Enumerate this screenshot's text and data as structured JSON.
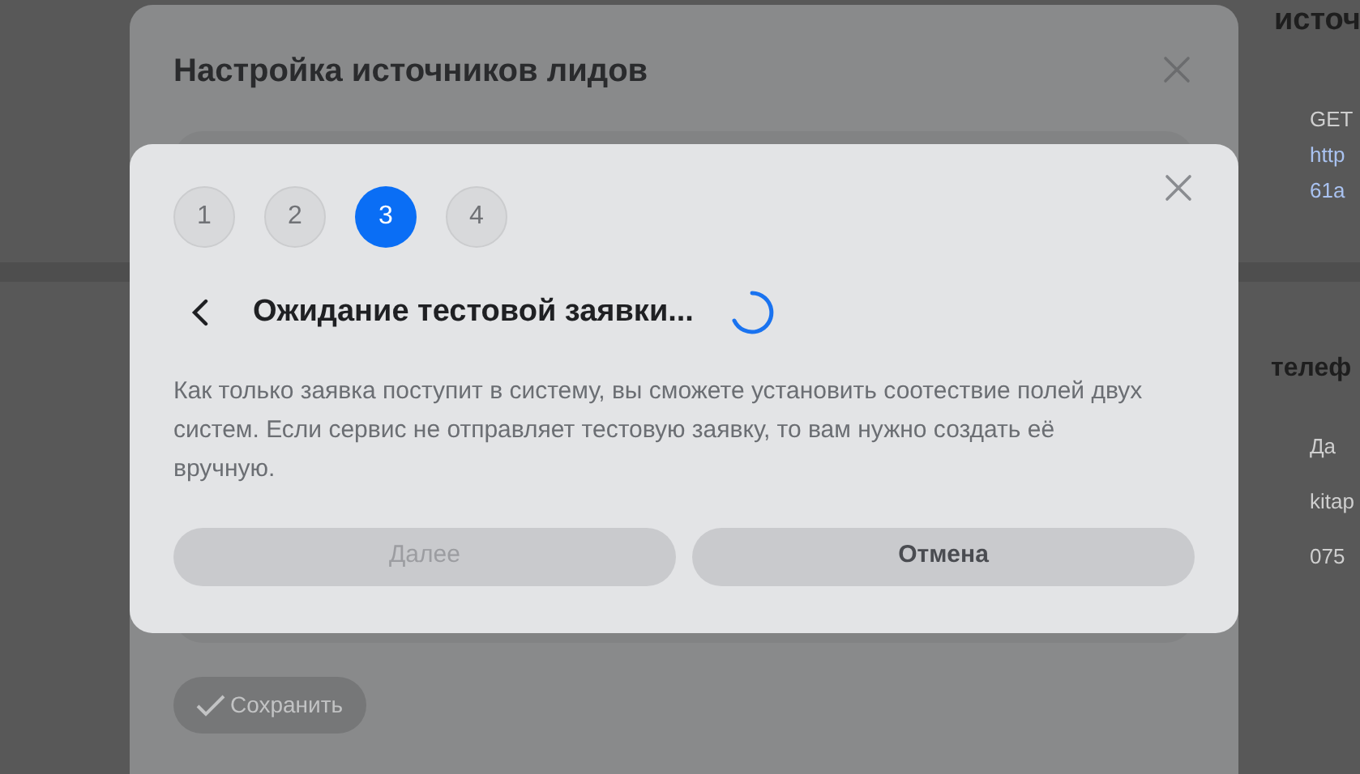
{
  "background_page": {
    "heading": "источ",
    "request": [
      {
        "kind": "method",
        "text": "GET"
      },
      {
        "kind": "link",
        "text": "http"
      },
      {
        "kind": "link",
        "text": "61a"
      }
    ],
    "section_heading": "телеф",
    "values": [
      "Да",
      "kitap",
      "075"
    ]
  },
  "settings_dialog": {
    "title": "Настройка источников лидов",
    "save_button": {
      "label": "Сохранить",
      "disabled": true
    }
  },
  "wizard_dialog": {
    "steps": [
      {
        "label": "1",
        "selected": false
      },
      {
        "label": "2",
        "selected": false
      },
      {
        "label": "3",
        "selected": true
      },
      {
        "label": "4",
        "selected": false
      }
    ],
    "title": "Ожидание тестовой заявки...",
    "loading": true,
    "description": "Как только заявка поступит в систему, вы сможете установить соотествие полей двух систем. Если сервис не отправляет тестовую заявку, то вам нужно создать её вручную.",
    "buttons": [
      {
        "label": "Далее",
        "kind": "primary",
        "disabled": true
      },
      {
        "label": "Отмена",
        "kind": "secondary",
        "disabled": false
      }
    ]
  }
}
